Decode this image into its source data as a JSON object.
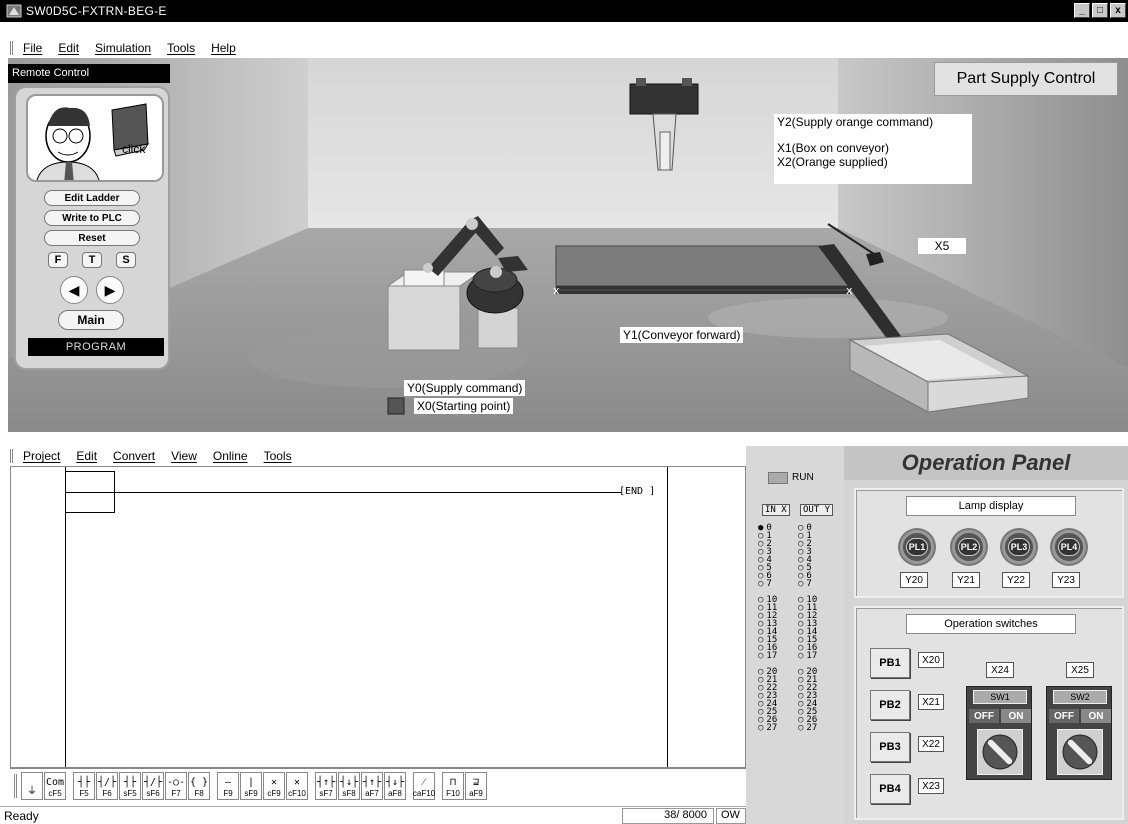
{
  "window": {
    "title": "SW0D5C-FXTRN-BEG-E",
    "minimize": "_",
    "restore": "□",
    "close": "x"
  },
  "sim_menu": [
    "File",
    "Edit",
    "Simulation",
    "Tools",
    "Help"
  ],
  "remote": {
    "title": "Remote Control",
    "click_label": "click",
    "buttons": {
      "edit_ladder": "Edit Ladder",
      "write_plc": "Write to PLC",
      "reset": "Reset"
    },
    "fts": [
      "F",
      "T",
      "S"
    ],
    "arrows": {
      "left": "◀",
      "right": "▶"
    },
    "main": "Main",
    "mode": "PROGRAM"
  },
  "scene": {
    "title": "Part Supply Control",
    "labels": {
      "y2": "Y2(Supply orange command)",
      "x1": "X1(Box on conveyor)",
      "x2": "X2(Orange supplied)",
      "x5": "X5",
      "y1": "Y1(Conveyor forward)",
      "y0": "Y0(Supply command)",
      "x0": "X0(Starting point)"
    }
  },
  "ladder_menu": [
    "Project",
    "Edit",
    "Convert",
    "View",
    "Online",
    "Tools"
  ],
  "ladder": {
    "end_label": "[END  ]"
  },
  "toolbar": [
    {
      "sym": "⏚",
      "key": ""
    },
    {
      "sym": "Com",
      "key": "cF5"
    },
    {
      "sym": "┤├",
      "key": "F5"
    },
    {
      "sym": "┤/├",
      "key": "F6"
    },
    {
      "sym": "┤├",
      "key": "sF5"
    },
    {
      "sym": "┤/├",
      "key": "sF6"
    },
    {
      "sym": "-○-",
      "key": "F7"
    },
    {
      "sym": "{ }",
      "key": "F8"
    },
    {
      "sym": "—",
      "key": "F9"
    },
    {
      "sym": "|",
      "key": "sF9"
    },
    {
      "sym": "✕",
      "key": "cF9"
    },
    {
      "sym": "✕",
      "key": "cF10"
    },
    {
      "sym": "┤↑├",
      "key": "sF7"
    },
    {
      "sym": "┤↓├",
      "key": "sF8"
    },
    {
      "sym": "┤↑├",
      "key": "aF7"
    },
    {
      "sym": "┤↓├",
      "key": "aF8"
    },
    {
      "sym": "⁄",
      "key": "caF10"
    },
    {
      "sym": "⊓",
      "key": "F10"
    },
    {
      "sym": "⊒",
      "key": "aF9"
    }
  ],
  "status": {
    "text": "Ready",
    "count": "38/ 8000",
    "mode": "OW"
  },
  "io": {
    "run": "RUN",
    "in_header": "IN X",
    "out_header": "OUT Y",
    "in": [
      "0",
      "1",
      "2",
      "3",
      "4",
      "5",
      "6",
      "7",
      "10",
      "11",
      "12",
      "13",
      "14",
      "15",
      "16",
      "17",
      "20",
      "21",
      "22",
      "23",
      "24",
      "25",
      "26",
      "27"
    ],
    "out": [
      "0",
      "1",
      "2",
      "3",
      "4",
      "5",
      "6",
      "7",
      "10",
      "11",
      "12",
      "13",
      "14",
      "15",
      "16",
      "17",
      "20",
      "21",
      "22",
      "23",
      "24",
      "25",
      "26",
      "27"
    ],
    "active_in": [
      "0"
    ]
  },
  "panel": {
    "title": "Operation Panel",
    "lamp_title": "Lamp display",
    "lamps": [
      {
        "label": "PL1",
        "addr": "Y20"
      },
      {
        "label": "PL2",
        "addr": "Y21"
      },
      {
        "label": "PL3",
        "addr": "Y22"
      },
      {
        "label": "PL4",
        "addr": "Y23"
      }
    ],
    "switch_title": "Operation switches",
    "pbs": [
      {
        "label": "PB1",
        "addr": "X20"
      },
      {
        "label": "PB2",
        "addr": "X21"
      },
      {
        "label": "PB3",
        "addr": "X22"
      },
      {
        "label": "PB4",
        "addr": "X23"
      }
    ],
    "selectors": [
      {
        "label": "SW1",
        "addr": "X24",
        "off": "OFF",
        "on": "ON"
      },
      {
        "label": "SW2",
        "addr": "X25",
        "off": "OFF",
        "on": "ON"
      }
    ]
  }
}
